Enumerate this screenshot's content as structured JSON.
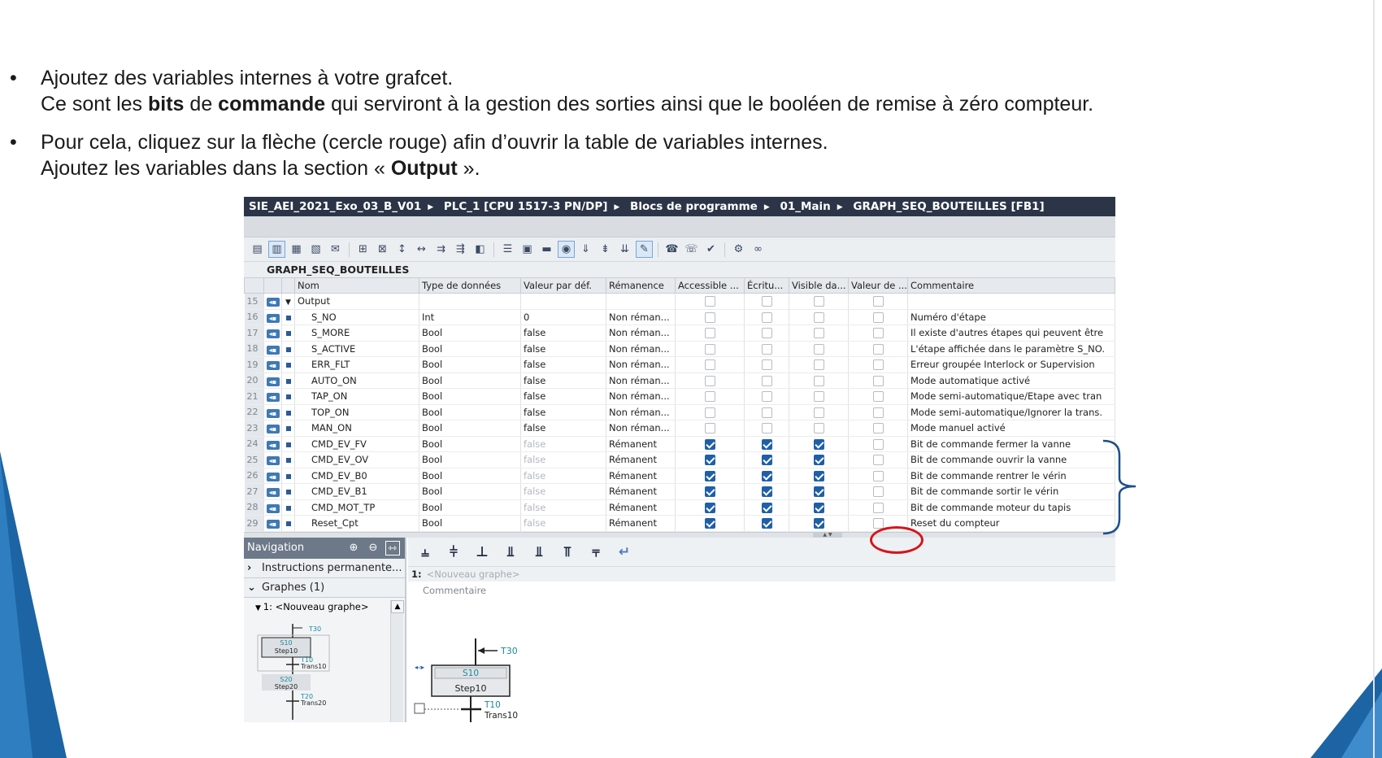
{
  "slide": {
    "bullet1_line1": "Ajoutez des variables internes à votre grafcet.",
    "bullet1_line2_pre": "Ce sont les ",
    "bullet1_bold1": "bits",
    "bullet1_mid": " de ",
    "bullet1_bold2": "commande",
    "bullet1_post": " qui serviront à la gestion des sorties ainsi que le booléen de remise à zéro compteur.",
    "bullet2_line1": "Pour cela, cliquez sur la flèche (cercle rouge) afin d’ouvrir la table de variables internes.",
    "bullet2_line2_pre": "Ajoutez les variables dans la section « ",
    "bullet2_bold": "Output",
    "bullet2_line2_post": " ».",
    "bullet_symbol": "•"
  },
  "app": {
    "breadcrumb": [
      "SIE_AEI_2021_Exo_03_B_V01",
      "PLC_1 [CPU 1517-3 PN/DP]",
      "Blocs de programme",
      "01_Main",
      "GRAPH_SEQ_BOUTEILLES [FB1]"
    ],
    "block_name": "GRAPH_SEQ_BOUTEILLES",
    "columns": [
      "Nom",
      "Type de données",
      "Valeur par déf.",
      "Rémanence",
      "Accessible ...",
      "Écritu...",
      "Visible da...",
      "Valeur de ...",
      "Commentaire"
    ],
    "section_row": {
      "num": "15",
      "name": "Output"
    },
    "rows": [
      {
        "num": "16",
        "name": "S_NO",
        "type": "Int",
        "default": "0",
        "retain": "Non réman...",
        "access": false,
        "write": false,
        "visible": false,
        "comment": "Numéro d'étape"
      },
      {
        "num": "17",
        "name": "S_MORE",
        "type": "Bool",
        "default": "false",
        "retain": "Non réman...",
        "access": false,
        "write": false,
        "visible": false,
        "comment": "Il existe d'autres étapes qui peuvent être"
      },
      {
        "num": "18",
        "name": "S_ACTIVE",
        "type": "Bool",
        "default": "false",
        "retain": "Non réman...",
        "access": false,
        "write": false,
        "visible": false,
        "comment": "L'étape affichée dans le paramètre S_NO."
      },
      {
        "num": "19",
        "name": "ERR_FLT",
        "type": "Bool",
        "default": "false",
        "retain": "Non réman...",
        "access": false,
        "write": false,
        "visible": false,
        "comment": "Erreur groupée Interlock or Supervision"
      },
      {
        "num": "20",
        "name": "AUTO_ON",
        "type": "Bool",
        "default": "false",
        "retain": "Non réman...",
        "access": false,
        "write": false,
        "visible": false,
        "comment": "Mode automatique activé"
      },
      {
        "num": "21",
        "name": "TAP_ON",
        "type": "Bool",
        "default": "false",
        "retain": "Non réman...",
        "access": false,
        "write": false,
        "visible": false,
        "comment": "Mode semi-automatique/Etape avec tran"
      },
      {
        "num": "22",
        "name": "TOP_ON",
        "type": "Bool",
        "default": "false",
        "retain": "Non réman...",
        "access": false,
        "write": false,
        "visible": false,
        "comment": "Mode semi-automatique/Ignorer la trans."
      },
      {
        "num": "23",
        "name": "MAN_ON",
        "type": "Bool",
        "default": "false",
        "retain": "Non réman...",
        "access": false,
        "write": false,
        "visible": false,
        "comment": "Mode manuel activé"
      },
      {
        "num": "24",
        "name": "CMD_EV_FV",
        "type": "Bool",
        "default": "false",
        "retain": "Rémanent",
        "access": true,
        "write": true,
        "visible": true,
        "comment": "Bit de commande fermer la vanne"
      },
      {
        "num": "25",
        "name": "CMD_EV_OV",
        "type": "Bool",
        "default": "false",
        "retain": "Rémanent",
        "access": true,
        "write": true,
        "visible": true,
        "comment": "Bit de commande ouvrir la vanne"
      },
      {
        "num": "26",
        "name": "CMD_EV_B0",
        "type": "Bool",
        "default": "false",
        "retain": "Rémanent",
        "access": true,
        "write": true,
        "visible": true,
        "comment": "Bit de commande rentrer le vérin"
      },
      {
        "num": "27",
        "name": "CMD_EV_B1",
        "type": "Bool",
        "default": "false",
        "retain": "Rémanent",
        "access": true,
        "write": true,
        "visible": true,
        "comment": "Bit de commande sortir le vérin"
      },
      {
        "num": "28",
        "name": "CMD_MOT_TP",
        "type": "Bool",
        "default": "false",
        "retain": "Rémanent",
        "access": true,
        "write": true,
        "visible": true,
        "comment": "Bit de commande moteur du tapis"
      },
      {
        "num": "29",
        "name": "Reset_Cpt",
        "type": "Bool",
        "default": "false",
        "retain": "Rémanent",
        "access": true,
        "write": true,
        "visible": true,
        "comment": "Reset du compteur"
      }
    ],
    "navigation": {
      "title": "Navigation",
      "items": [
        "Instructions permanente...",
        "Graphes (1)"
      ],
      "tree_item": "1: <Nouveau graphe>",
      "mini": {
        "t30": "T30",
        "s10": "S10",
        "step10": "Step10",
        "t10": "T10",
        "trans10": "Trans10",
        "s20": "S20",
        "step20": "Step20",
        "t20": "T20",
        "trans20": "Trans20"
      }
    },
    "editor": {
      "graph_num": "1:",
      "graph_placeholder": "<Nouveau graphe>",
      "comment_label": "Commentaire",
      "t30": "T30",
      "s10": "S10",
      "step10": "Step10",
      "t10": "T10",
      "trans10": "Trans10"
    }
  },
  "colors": {
    "titlebar": "#2c3548",
    "accent_blue": "#1f5fa8",
    "deco_blue": "#1c64a3",
    "red_circle": "#d6141b",
    "brace": "#1b4f8a"
  }
}
